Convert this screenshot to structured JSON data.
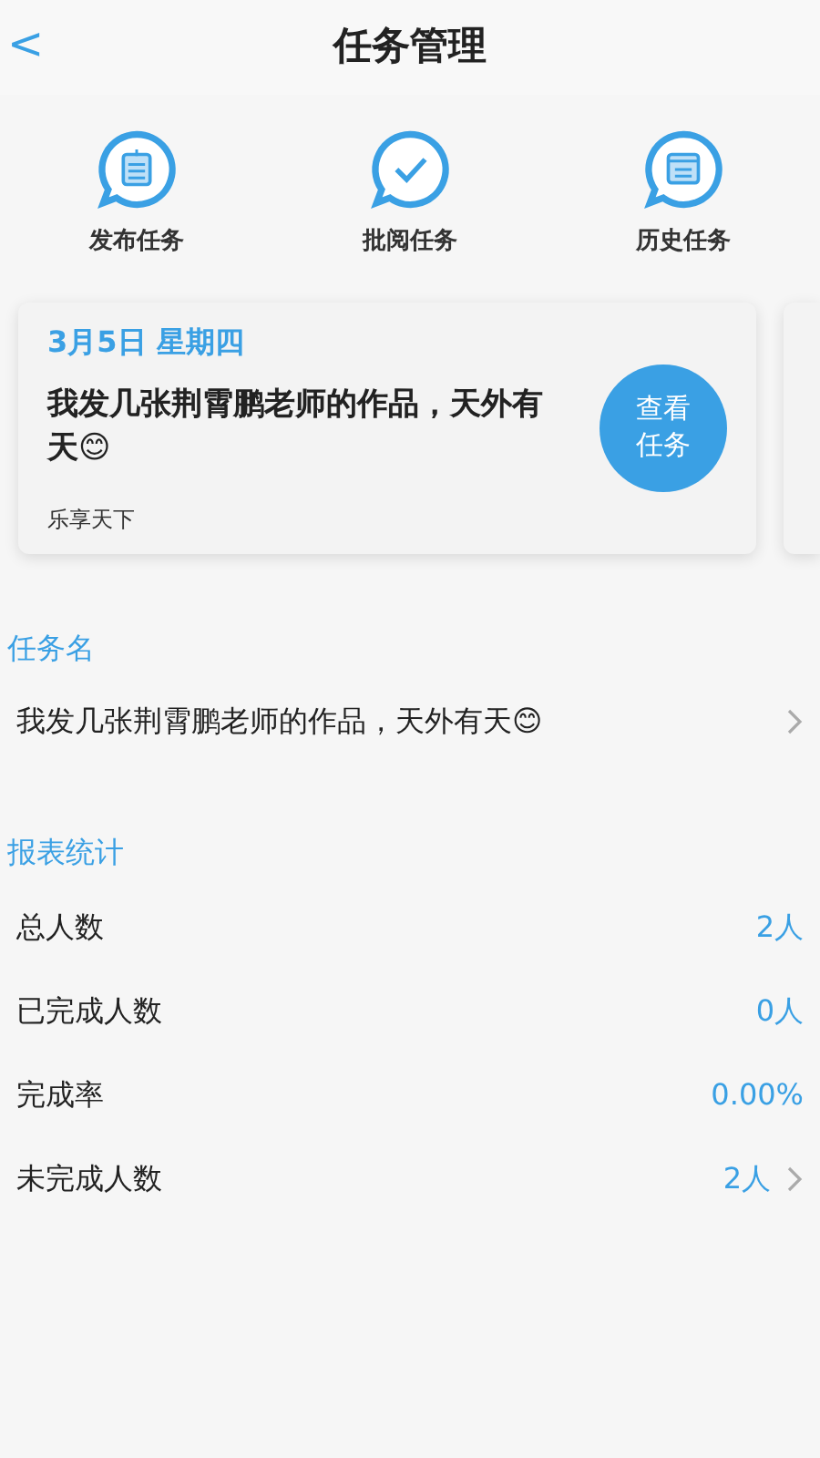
{
  "header": {
    "back": "<",
    "title": "任务管理"
  },
  "actions": [
    {
      "kind": "publish",
      "label": "发布任务"
    },
    {
      "kind": "review",
      "label": "批阅任务"
    },
    {
      "kind": "history",
      "label": "历史任务"
    }
  ],
  "task_card": {
    "date": "3月5日 星期四",
    "title": "我发几张荆霄鹏老师的作品，天外有天😊",
    "author": "乐享天下",
    "button": "查看任务"
  },
  "task_name": {
    "heading": "任务名",
    "value": "我发几张荆霄鹏老师的作品，天外有天😊"
  },
  "stats": {
    "heading": "报表统计",
    "rows": [
      {
        "label": "总人数",
        "value": "2人",
        "chevron": false
      },
      {
        "label": "已完成人数",
        "value": "0人",
        "chevron": false
      },
      {
        "label": "完成率",
        "value": "0.00%",
        "chevron": false
      },
      {
        "label": "未完成人数",
        "value": "2人",
        "chevron": true
      }
    ]
  }
}
